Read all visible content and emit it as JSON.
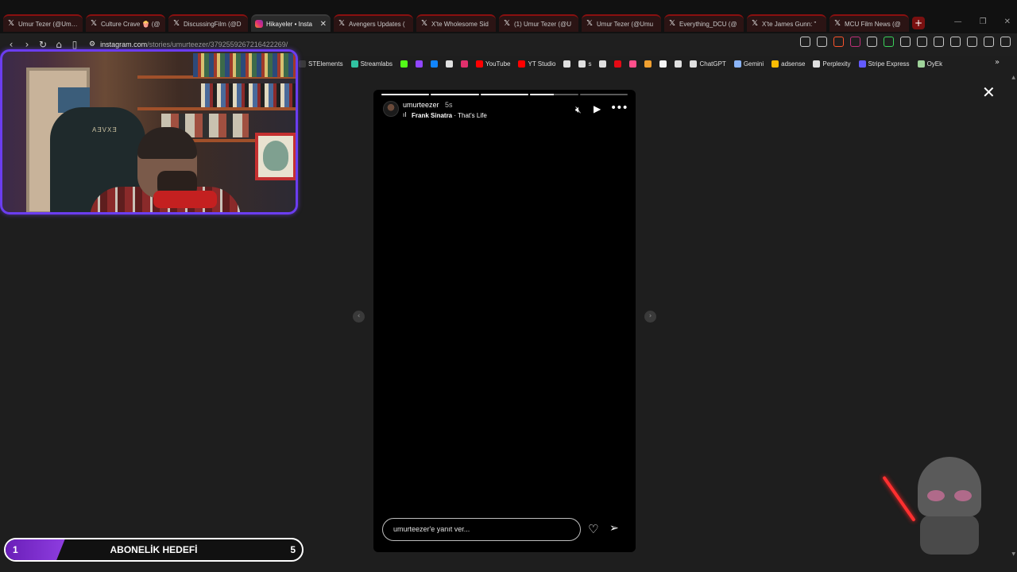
{
  "tabs": [
    {
      "title": "Umur Tezer (@Um…",
      "icon": "x-icon",
      "active": false
    },
    {
      "title": "Culture Crave 🍿 (@",
      "icon": "x-icon",
      "active": false
    },
    {
      "title": "DiscussingFilm (@D",
      "icon": "x-icon",
      "active": false
    },
    {
      "title": "Hikayeler • Insta",
      "icon": "instagram-icon",
      "active": true
    },
    {
      "title": "Avengers Updates (",
      "icon": "x-icon",
      "active": false
    },
    {
      "title": "X'te Wholesome Sid",
      "icon": "x-icon",
      "active": false
    },
    {
      "title": "(1) Umur Tezer (@U",
      "icon": "x-icon",
      "active": false
    },
    {
      "title": "Umur Tezer (@Umu",
      "icon": "x-icon",
      "active": false
    },
    {
      "title": "Everything_DCU (@",
      "icon": "x-icon",
      "active": false
    },
    {
      "title": "X'te James Gunn: \"",
      "icon": "x-icon",
      "active": false
    },
    {
      "title": "MCU Film News (@",
      "icon": "x-icon",
      "active": false
    }
  ],
  "new_tab_label": "+",
  "address": {
    "host": "instagram.com",
    "path": "/stories/umurteezer/3792559267216422269/"
  },
  "bookmarks": [
    {
      "label": "STElements",
      "color": "#3a3a3a"
    },
    {
      "label": "Streamlabs",
      "color": "#31c3a2"
    },
    {
      "label": "",
      "color": "#53fc18"
    },
    {
      "label": "",
      "color": "#9146ff"
    },
    {
      "label": "",
      "color": "#1185fe"
    },
    {
      "label": "",
      "color": "#e0e0e0"
    },
    {
      "label": "",
      "color": "#e1306c"
    },
    {
      "label": "YouTube",
      "color": "#ff0000"
    },
    {
      "label": "YT Studio",
      "color": "#ff0000"
    },
    {
      "label": "",
      "color": "#e0e0e0"
    },
    {
      "label": "s",
      "color": "#e0e0e0"
    },
    {
      "label": "",
      "color": "#e0e0e0"
    },
    {
      "label": "",
      "color": "#e50914"
    },
    {
      "label": "",
      "color": "#ff4f8b"
    },
    {
      "label": "",
      "color": "#f0a030"
    },
    {
      "label": "",
      "color": "#f5f5f5"
    },
    {
      "label": "",
      "color": "#e0e0e0"
    },
    {
      "label": "ChatGPT",
      "color": "#e0e0e0"
    },
    {
      "label": "Gemini",
      "color": "#8ab4f8"
    },
    {
      "label": "adsense",
      "color": "#fbbc04"
    },
    {
      "label": "Perplexity",
      "color": "#e0e0e0"
    },
    {
      "label": "Stripe Express",
      "color": "#635bff"
    },
    {
      "label": "OyEk",
      "color": "#9fd39a"
    }
  ],
  "story": {
    "username": "umurteezer",
    "time": "5s",
    "song_artist": "Frank Sinatra",
    "song_separator": " · ",
    "song_title": "That's Life",
    "progress": [
      1,
      1,
      1,
      0.5,
      0
    ],
    "reply_placeholder": "umurteezer'e yanıt ver..."
  },
  "webcam": {
    "chair_logo": "AƎVXƎ"
  },
  "goal": {
    "min": "1",
    "label": "ABONELİK HEDEFİ",
    "max": "5",
    "fill_fraction": 0.2
  },
  "colors": {
    "accent_purple": "#6b3df0",
    "tab_red": "#8a1010",
    "saber_red": "#ff3030"
  }
}
